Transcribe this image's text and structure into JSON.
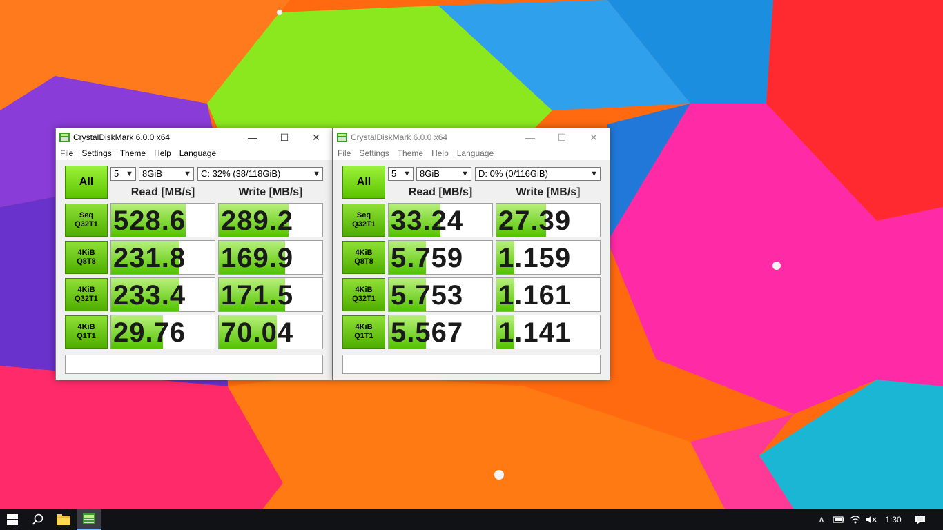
{
  "windows": [
    {
      "title": "CrystalDiskMark 6.0.0 x64",
      "menu": [
        "File",
        "Settings",
        "Theme",
        "Help",
        "Language"
      ],
      "all_label": "All",
      "count": "5",
      "size": "8GiB",
      "drive": "C: 32% (38/118GiB)",
      "read_header": "Read [MB/s]",
      "write_header": "Write [MB/s]",
      "rows": [
        {
          "l1": "Seq",
          "l2": "Q32T1",
          "read": "528.6",
          "write": "289.2",
          "read_fill": 0.72,
          "write_fill": 0.67
        },
        {
          "l1": "4KiB",
          "l2": "Q8T8",
          "read": "231.8",
          "write": "169.9",
          "read_fill": 0.66,
          "write_fill": 0.64
        },
        {
          "l1": "4KiB",
          "l2": "Q32T1",
          "read": "233.4",
          "write": "171.5",
          "read_fill": 0.66,
          "write_fill": 0.64
        },
        {
          "l1": "4KiB",
          "l2": "Q1T1",
          "read": "29.76",
          "write": "70.04",
          "read_fill": 0.5,
          "write_fill": 0.56
        }
      ],
      "comment": ""
    },
    {
      "title": "CrystalDiskMark 6.0.0 x64",
      "menu": [
        "File",
        "Settings",
        "Theme",
        "Help",
        "Language"
      ],
      "all_label": "All",
      "count": "5",
      "size": "8GiB",
      "drive": "D: 0% (0/116GiB)",
      "read_header": "Read [MB/s]",
      "write_header": "Write [MB/s]",
      "rows": [
        {
          "l1": "Seq",
          "l2": "Q32T1",
          "read": "33.24",
          "write": "27.39",
          "read_fill": 0.5,
          "write_fill": 0.48
        },
        {
          "l1": "4KiB",
          "l2": "Q8T8",
          "read": "5.759",
          "write": "1.159",
          "read_fill": 0.36,
          "write_fill": 0.17
        },
        {
          "l1": "4KiB",
          "l2": "Q32T1",
          "read": "5.753",
          "write": "1.161",
          "read_fill": 0.36,
          "write_fill": 0.17
        },
        {
          "l1": "4KiB",
          "l2": "Q1T1",
          "read": "5.567",
          "write": "1.141",
          "read_fill": 0.36,
          "write_fill": 0.17
        }
      ],
      "comment": ""
    }
  ],
  "taskbar": {
    "clock": "1:30",
    "icons": [
      "windows-start-icon",
      "search-icon",
      "file-explorer-icon",
      "crystaldiskmark-icon"
    ],
    "tray_icons": [
      "chevron-up-icon",
      "battery-icon",
      "wifi-icon",
      "volume-muted-icon",
      "notification-icon"
    ]
  },
  "colors": {
    "accent_green": "#5cc300",
    "taskbar": "#101216"
  }
}
